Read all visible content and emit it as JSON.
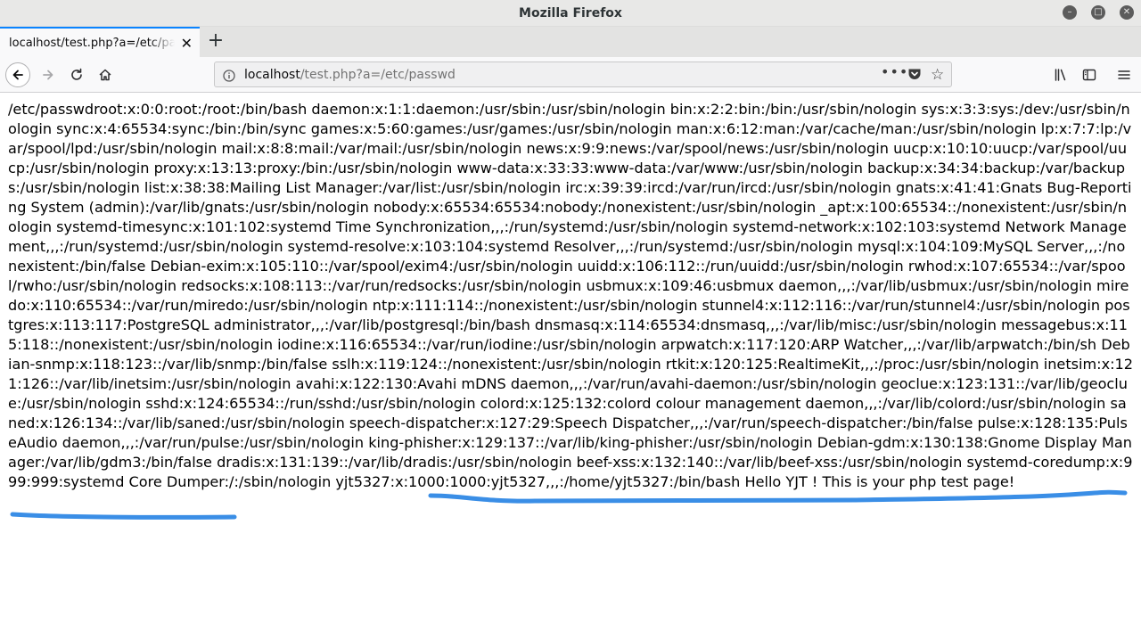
{
  "window": {
    "title": "Mozilla Firefox"
  },
  "tabs": [
    {
      "label": "localhost/test.php?a=/etc/passwd",
      "active": true
    }
  ],
  "navbar": {
    "url_host": "localhost",
    "url_path": "/test.php?a=/etc/passwd",
    "page_actions_label": "•••"
  },
  "page": {
    "text": "/etc/passwdroot:x:0:0:root:/root:/bin/bash daemon:x:1:1:daemon:/usr/sbin:/usr/sbin/nologin bin:x:2:2:bin:/bin:/usr/sbin/nologin sys:x:3:3:sys:/dev:/usr/sbin/nologin sync:x:4:65534:sync:/bin:/bin/sync games:x:5:60:games:/usr/games:/usr/sbin/nologin man:x:6:12:man:/var/cache/man:/usr/sbin/nologin lp:x:7:7:lp:/var/spool/lpd:/usr/sbin/nologin mail:x:8:8:mail:/var/mail:/usr/sbin/nologin news:x:9:9:news:/var/spool/news:/usr/sbin/nologin uucp:x:10:10:uucp:/var/spool/uucp:/usr/sbin/nologin proxy:x:13:13:proxy:/bin:/usr/sbin/nologin www-data:x:33:33:www-data:/var/www:/usr/sbin/nologin backup:x:34:34:backup:/var/backups:/usr/sbin/nologin list:x:38:38:Mailing List Manager:/var/list:/usr/sbin/nologin irc:x:39:39:ircd:/var/run/ircd:/usr/sbin/nologin gnats:x:41:41:Gnats Bug-Reporting System (admin):/var/lib/gnats:/usr/sbin/nologin nobody:x:65534:65534:nobody:/nonexistent:/usr/sbin/nologin _apt:x:100:65534::/nonexistent:/usr/sbin/nologin systemd-timesync:x:101:102:systemd Time Synchronization,,,:/run/systemd:/usr/sbin/nologin systemd-network:x:102:103:systemd Network Management,,,:/run/systemd:/usr/sbin/nologin systemd-resolve:x:103:104:systemd Resolver,,,:/run/systemd:/usr/sbin/nologin mysql:x:104:109:MySQL Server,,,:/nonexistent:/bin/false Debian-exim:x:105:110::/var/spool/exim4:/usr/sbin/nologin uuidd:x:106:112::/run/uuidd:/usr/sbin/nologin rwhod:x:107:65534::/var/spool/rwho:/usr/sbin/nologin redsocks:x:108:113::/var/run/redsocks:/usr/sbin/nologin usbmux:x:109:46:usbmux daemon,,,:/var/lib/usbmux:/usr/sbin/nologin miredo:x:110:65534::/var/run/miredo:/usr/sbin/nologin ntp:x:111:114::/nonexistent:/usr/sbin/nologin stunnel4:x:112:116::/var/run/stunnel4:/usr/sbin/nologin postgres:x:113:117:PostgreSQL administrator,,,:/var/lib/postgresql:/bin/bash dnsmasq:x:114:65534:dnsmasq,,,:/var/lib/misc:/usr/sbin/nologin messagebus:x:115:118::/nonexistent:/usr/sbin/nologin iodine:x:116:65534::/var/run/iodine:/usr/sbin/nologin arpwatch:x:117:120:ARP Watcher,,,:/var/lib/arpwatch:/bin/sh Debian-snmp:x:118:123::/var/lib/snmp:/bin/false sslh:x:119:124::/nonexistent:/usr/sbin/nologin rtkit:x:120:125:RealtimeKit,,,:/proc:/usr/sbin/nologin inetsim:x:121:126::/var/lib/inetsim:/usr/sbin/nologin avahi:x:122:130:Avahi mDNS daemon,,,:/var/run/avahi-daemon:/usr/sbin/nologin geoclue:x:123:131::/var/lib/geoclue:/usr/sbin/nologin sshd:x:124:65534::/run/sshd:/usr/sbin/nologin colord:x:125:132:colord colour management daemon,,,:/var/lib/colord:/usr/sbin/nologin saned:x:126:134::/var/lib/saned:/usr/sbin/nologin speech-dispatcher:x:127:29:Speech Dispatcher,,,:/var/run/speech-dispatcher:/bin/false pulse:x:128:135:PulseAudio daemon,,,:/var/run/pulse:/usr/sbin/nologin king-phisher:x:129:137::/var/lib/king-phisher:/usr/sbin/nologin Debian-gdm:x:130:138:Gnome Display Manager:/var/lib/gdm3:/bin/false dradis:x:131:139::/var/lib/dradis:/usr/sbin/nologin beef-xss:x:132:140::/var/lib/beef-xss:/usr/sbin/nologin systemd-coredump:x:999:999:systemd Core Dumper:/:/sbin/nologin yjt5327:x:1000:1000:yjt5327,,,:/home/yjt5327:/bin/bash Hello YJT ! This is your php test page!"
  },
  "colors": {
    "annotation_stroke": "#3a8ee6",
    "tab_accent": "#0a84ff"
  }
}
